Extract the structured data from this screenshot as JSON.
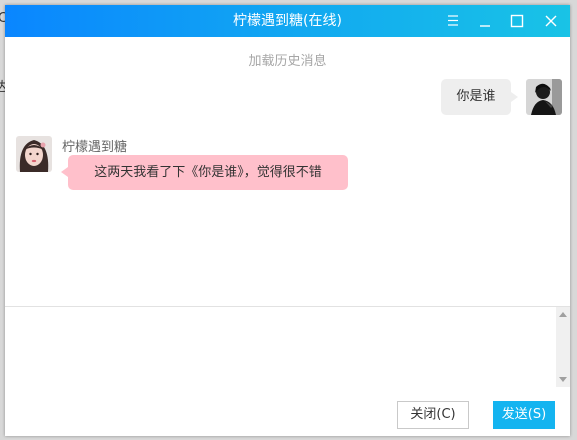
{
  "window": {
    "title": "柠檬遇到糖(在线)"
  },
  "background_fragments": [
    "C",
    "达"
  ],
  "chat": {
    "load_history": "加载历史消息",
    "messages": [
      {
        "side": "right",
        "text": "你是谁"
      },
      {
        "side": "left",
        "sender": "柠檬遇到糖",
        "text": "这两天我看了下《你是谁》，觉得很不错"
      }
    ]
  },
  "input": {
    "value": ""
  },
  "footer": {
    "close_label": "关闭(C)",
    "send_label": "发送(S)"
  },
  "icons": {
    "menu": "menu-icon",
    "minimize": "minimize-icon",
    "maximize": "maximize-icon",
    "close": "close-icon"
  },
  "colors": {
    "titlebar_start": "#0a86ff",
    "titlebar_end": "#19c3e6",
    "received_bubble": "#ffc0cb",
    "sent_bubble": "#eeeeee",
    "send_button": "#14b4f0"
  }
}
